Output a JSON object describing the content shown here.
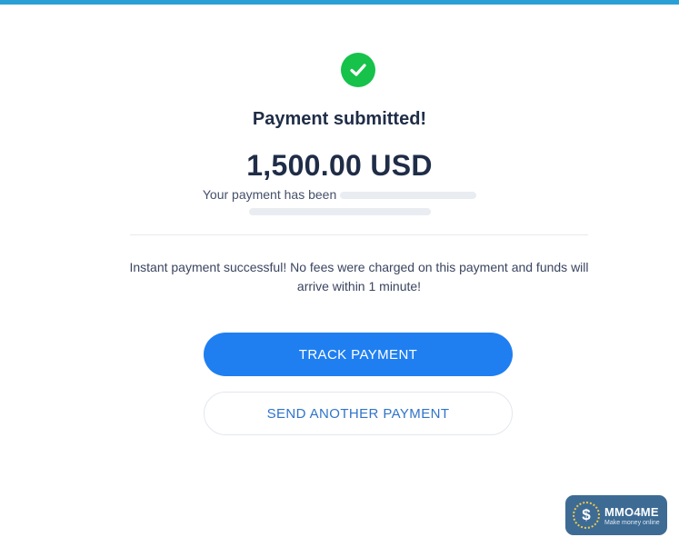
{
  "header": {
    "accent_color": "#2a9fd6"
  },
  "status": {
    "icon": "check-circle-icon",
    "color": "#16c24a"
  },
  "title": "Payment submitted!",
  "amount": "1,500.00 USD",
  "recipient_line": {
    "prefix": "Your payment has been"
  },
  "info_text": "Instant payment successful! No fees were charged on this payment and funds will arrive within 1 minute!",
  "actions": {
    "track_label": "TRACK PAYMENT",
    "send_another_label": "SEND ANOTHER PAYMENT",
    "primary_color": "#1f7ff0"
  },
  "watermark": {
    "name": "MMO4ME",
    "tagline": "Make money online"
  }
}
